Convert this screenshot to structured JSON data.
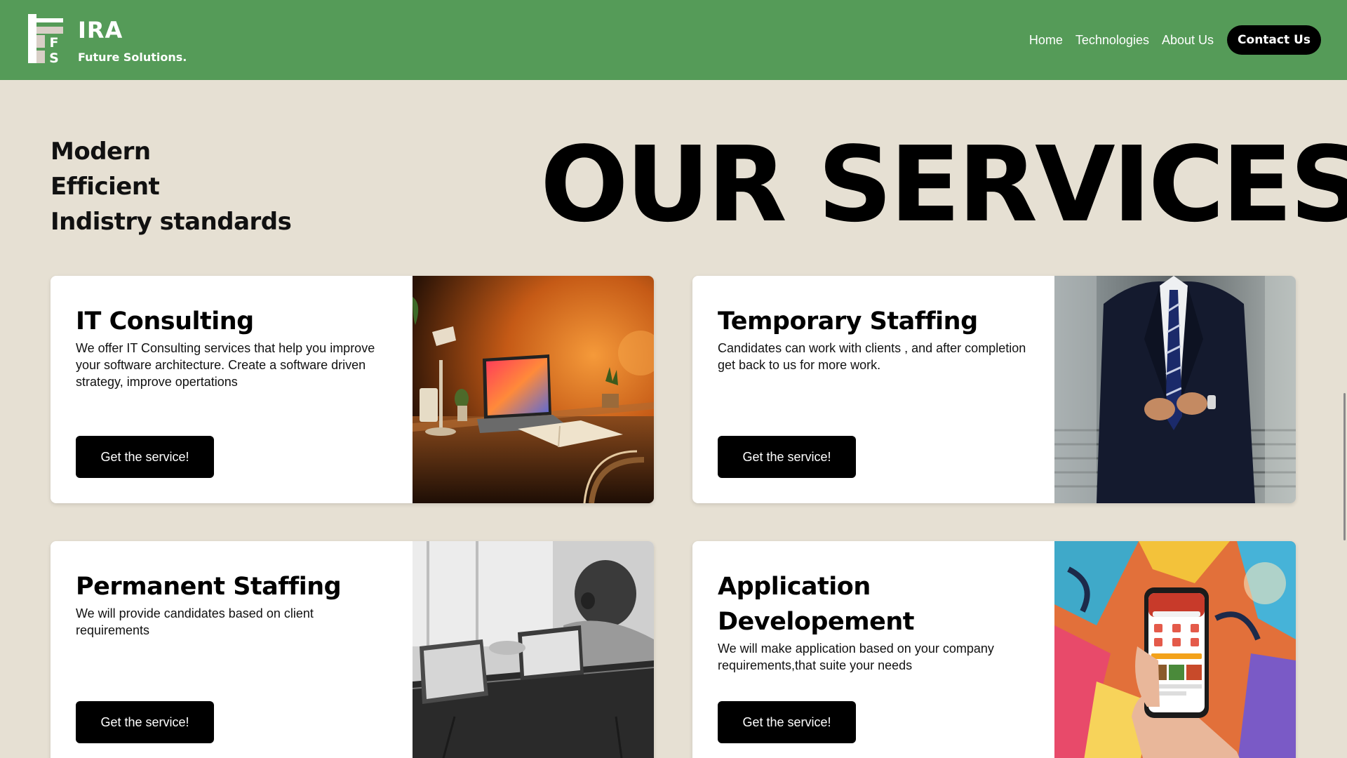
{
  "header": {
    "brand_name": "IRA",
    "brand_tagline": "Future Solutions.",
    "logo_letters": [
      "F",
      "S"
    ],
    "nav": [
      {
        "label": "Home"
      },
      {
        "label": "Technologies"
      },
      {
        "label": "About Us"
      }
    ],
    "contact_label": "Contact Us",
    "bg_color": "#559b58"
  },
  "hero": {
    "taglines": [
      "Modern",
      "Efficient",
      "Indistry standards"
    ],
    "title": "OUR SERVICES"
  },
  "services": [
    {
      "title": "IT Consulting",
      "description": "We offer IT Consulting services that help you improve your software architecture. Create a software driven strategy, improve opertations",
      "button": "Get the service!",
      "image": "laptop-desk-photo"
    },
    {
      "title": "Temporary Staffing",
      "description": "Candidates can work with clients , and after completion get back to us for more work.",
      "button": "Get the service!",
      "image": "business-suit-photo"
    },
    {
      "title": "Permanent Staffing",
      "description": "We will provide candidates based on client requirements",
      "button": "Get the service!",
      "image": "office-laptops-photo"
    },
    {
      "title": "Application Developement",
      "description": "We will make application based on your company requirements,that suite your needs",
      "button": "Get the service!",
      "image": "phone-app-photo"
    }
  ],
  "colors": {
    "page_bg": "#e6e0d3",
    "button": "#000000",
    "card": "#ffffff"
  }
}
